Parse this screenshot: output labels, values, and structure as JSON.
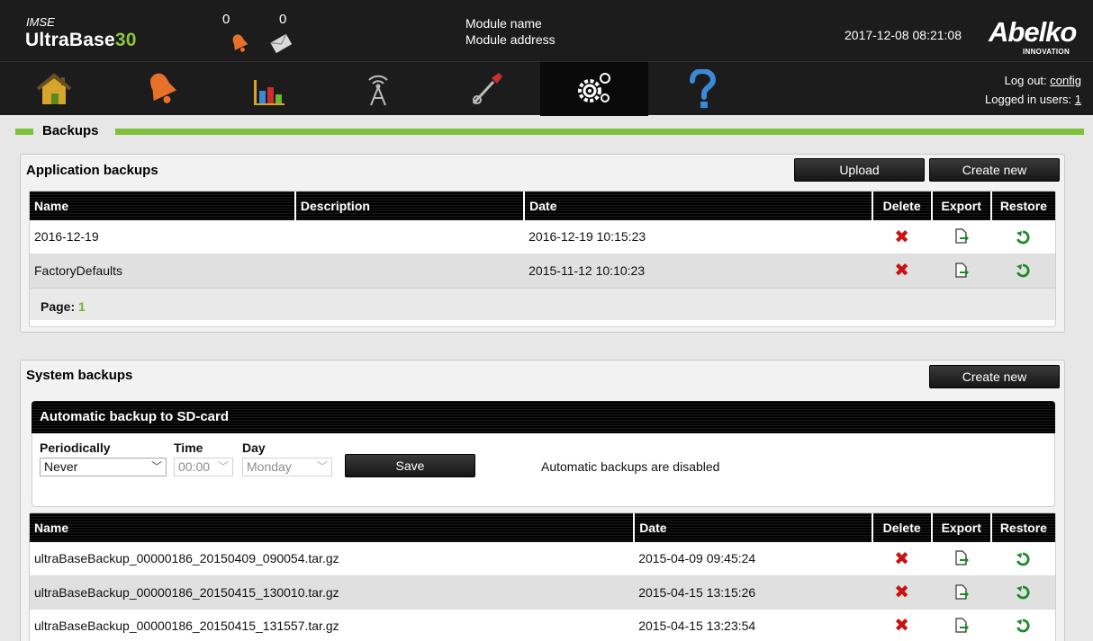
{
  "header": {
    "brand_top": "IMSE",
    "brand_main": "UltraBase",
    "brand_accent": "30",
    "alarm_count": "0",
    "message_count": "0",
    "module_name": "Module name",
    "module_address": "Module address",
    "datetime": "2017-12-08 08:21:08",
    "logo": "Abelko",
    "logo_sub": "INNOVATION"
  },
  "nav": {
    "items": [
      "home-icon",
      "alarm-bell-icon",
      "bar-chart-icon",
      "antenna-icon",
      "tools-icon",
      "settings-gears-icon",
      "help-icon"
    ],
    "active": "settings-gears-icon",
    "logout_label": "Log out:",
    "logout_user": "config",
    "logged_in_label": "Logged in users:",
    "logged_in_count": "1"
  },
  "page": {
    "title": "Backups"
  },
  "application_backups": {
    "title": "Application backups",
    "upload_label": "Upload",
    "create_label": "Create new",
    "columns": {
      "name": "Name",
      "description": "Description",
      "date": "Date",
      "delete": "Delete",
      "export": "Export",
      "restore": "Restore"
    },
    "rows": [
      {
        "name": "2016-12-19",
        "description": "",
        "date": "2016-12-19 10:15:23"
      },
      {
        "name": "FactoryDefaults",
        "description": "",
        "date": "2015-11-12 10:10:23"
      }
    ],
    "page_label": "Page:",
    "page_number": "1"
  },
  "system_backups": {
    "title": "System backups",
    "create_label": "Create new",
    "auto": {
      "title": "Automatic backup to SD-card",
      "periodically_label": "Periodically",
      "periodically_value": "Never",
      "time_label": "Time",
      "time_value": "00:00",
      "day_label": "Day",
      "day_value": "Monday",
      "save_label": "Save",
      "status": "Automatic backups are disabled"
    },
    "columns": {
      "name": "Name",
      "date": "Date",
      "delete": "Delete",
      "export": "Export",
      "restore": "Restore"
    },
    "rows": [
      {
        "name": "ultraBaseBackup_00000186_20150409_090054.tar.gz",
        "date": "2015-04-09 09:45:24"
      },
      {
        "name": "ultraBaseBackup_00000186_20150415_130010.tar.gz",
        "date": "2015-04-15 13:15:26"
      },
      {
        "name": "ultraBaseBackup_00000186_20150415_131557.tar.gz",
        "date": "2015-04-15 13:23:54"
      }
    ]
  },
  "colors": {
    "accent_green": "#7ec23a",
    "header_bg": "#1c1c1c",
    "delete_red": "#c91313",
    "restore_green": "#1e8a2a"
  }
}
